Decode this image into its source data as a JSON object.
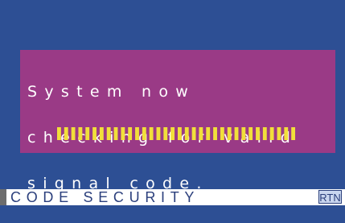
{
  "message": {
    "lines": [
      "System now",
      "checking for valid",
      "signal code."
    ]
  },
  "progress": {
    "segments": 34,
    "filled": 34
  },
  "footer": {
    "title": "CODE SECURITY",
    "rtn_label": "RTN"
  },
  "colors": {
    "screen_bg": "#2d4f94",
    "panel_bg": "#9a3a86",
    "text": "#ffffff",
    "progress_segment": "#f1df3a",
    "footer_bg": "#ffffff",
    "footer_text": "#2b3f7c"
  }
}
